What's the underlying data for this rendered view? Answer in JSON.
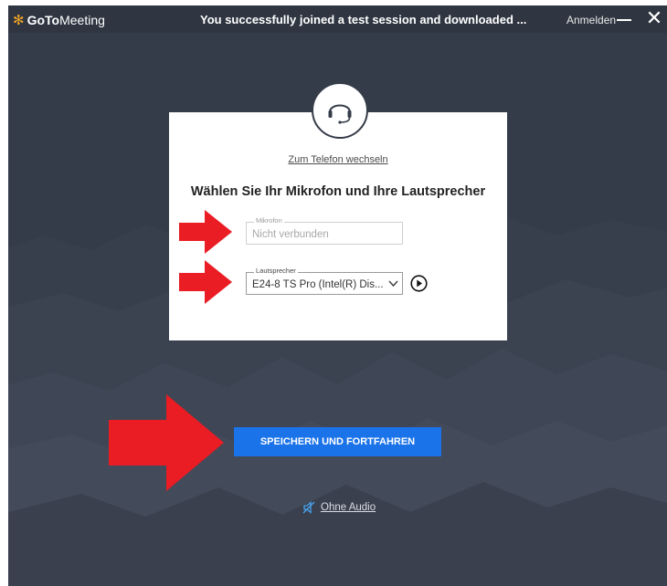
{
  "titlebar": {
    "logo_goto": "GoTo",
    "logo_meeting": "Meeting",
    "title": "You successfully joined a test session and downloaded ...",
    "signin_label": "Anmelden",
    "close_glyph": "✕"
  },
  "audio_setup": {
    "switch_phone_link": "Zum Telefon wechseln",
    "heading": "Wählen Sie Ihr Mikrofon und Ihre Lautsprecher",
    "microphone": {
      "label": "Mikrofon",
      "value": "Nicht verbunden"
    },
    "speaker": {
      "label": "Lautsprecher",
      "value": "E24-8 TS Pro (Intel(R) Dis..."
    },
    "save_button": "SPEICHERN UND FORTFAHREN",
    "no_audio_link": "Ohne Audio"
  },
  "colors": {
    "background": "#353c49",
    "titlebar": "#2f3541",
    "accent_blue": "#1a73e8",
    "logo_orange": "#f5a623",
    "arrow_red": "#ea1c24"
  },
  "icons": [
    "gotomeeting-logo-icon",
    "headset-icon",
    "chevron-down-icon",
    "play-icon",
    "speaker-muted-icon",
    "minimize-icon",
    "close-icon",
    "red-arrow-annotation"
  ]
}
